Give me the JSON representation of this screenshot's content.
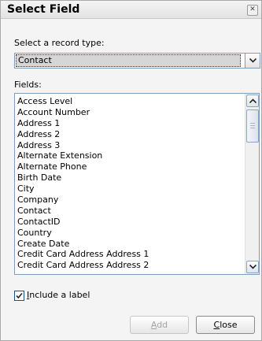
{
  "dialog": {
    "title": "Select Field",
    "close_icon": "close-icon"
  },
  "record_type": {
    "label": "Select a record type:",
    "selected": "Contact"
  },
  "fields": {
    "label": "Fields:",
    "items": [
      "Access Level",
      "Account Number",
      "Address 1",
      "Address 2",
      "Address 3",
      "Alternate Extension",
      "Alternate Phone",
      "Birth Date",
      "City",
      "Company",
      "Contact",
      "ContactID",
      "Country",
      "Create Date",
      "Credit Card Address Address 1",
      "Credit Card Address Address 2"
    ]
  },
  "include_label": {
    "checked": true,
    "label_accel": "I",
    "label_rest": "nclude a label"
  },
  "buttons": {
    "add_accel": "A",
    "add_rest": "dd",
    "close_accel": "C",
    "close_rest": "lose"
  }
}
